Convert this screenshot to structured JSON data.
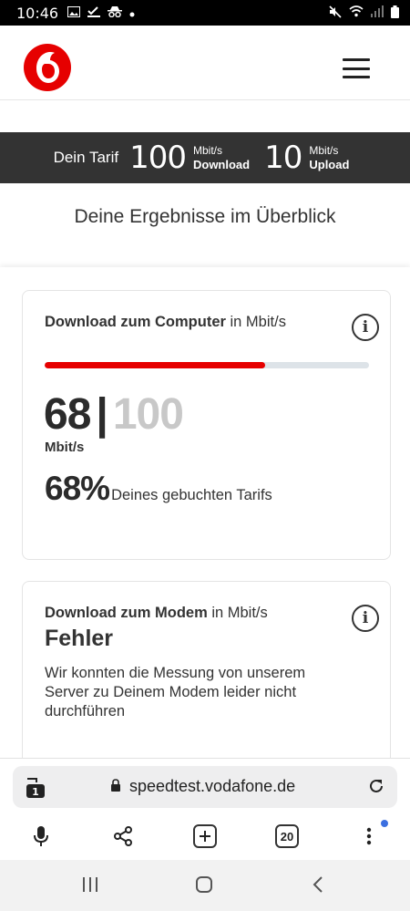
{
  "status_bar": {
    "time": "10:46"
  },
  "header": {
    "logo": "vodafone-logo",
    "menu_icon": "hamburger-icon"
  },
  "tariff": {
    "label": "Dein Tarif",
    "download_value": "100",
    "download_unit": "Mbit/s",
    "download_label": "Download",
    "upload_value": "10",
    "upload_unit": "Mbit/s",
    "upload_label": "Upload"
  },
  "overview_title": "Deine Ergebnisse im Überblick",
  "card_computer": {
    "title_bold": "Download zum Computer",
    "title_unit": " in Mbit/s",
    "measured": "68",
    "separator": "|",
    "booked": "100",
    "unit": "Mbit/s",
    "percent": "68%",
    "percent_text": "Deines gebuchten Tarifs",
    "progress_fraction": 0.68
  },
  "card_modem": {
    "title_bold": "Download zum Modem",
    "title_unit": " in Mbit/s",
    "error_title": "Fehler",
    "error_text": "Wir konnten die Messung von unserem Server zu Deinem Modem leider nicht durchführen"
  },
  "browser": {
    "tab_count_badge": "1",
    "url": "speedtest.vodafone.de",
    "open_tabs": "20"
  },
  "colors": {
    "brand_red": "#e60000",
    "tariff_bar": "#333333",
    "progress_track": "#dde3e8"
  }
}
